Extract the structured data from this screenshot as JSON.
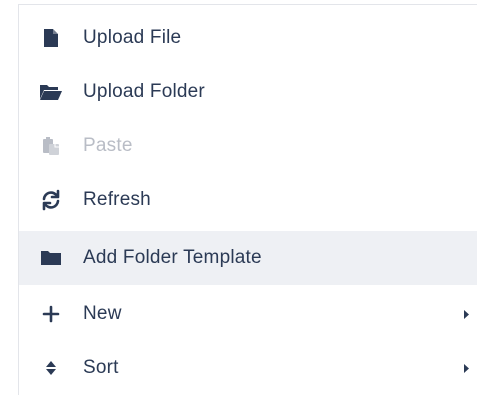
{
  "menu": {
    "items": [
      {
        "label": "Upload File",
        "icon": "file-icon",
        "disabled": false
      },
      {
        "label": "Upload Folder",
        "icon": "folder-open-icon",
        "disabled": false
      },
      {
        "label": "Paste",
        "icon": "paste-icon",
        "disabled": true
      },
      {
        "label": "Refresh",
        "icon": "refresh-icon",
        "disabled": false
      },
      {
        "label": "Add Folder Template",
        "icon": "folder-icon",
        "disabled": false,
        "highlighted": true
      },
      {
        "label": "New",
        "icon": "plus-icon",
        "disabled": false,
        "submenu": true
      },
      {
        "label": "Sort",
        "icon": "sort-icon",
        "disabled": false,
        "submenu": true
      }
    ]
  },
  "colors": {
    "text": "#2b3a55",
    "icon": "#2b3a55",
    "disabled": "#b9bdc6",
    "highlight_bg": "#eef0f4",
    "border": "#e3e5ea"
  }
}
